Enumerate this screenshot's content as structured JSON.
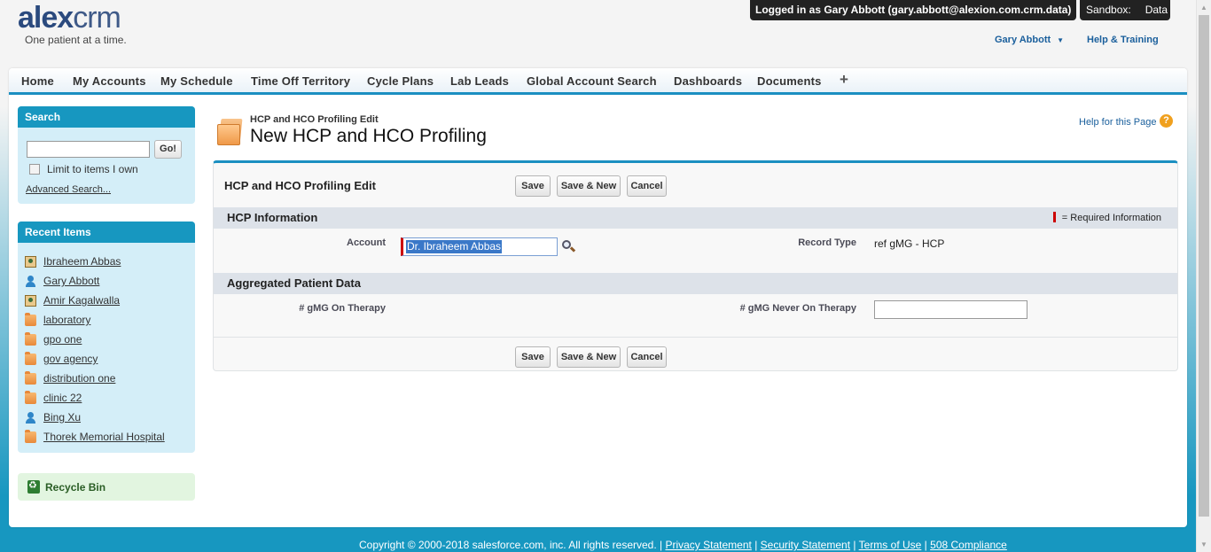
{
  "logo": {
    "brand_bold": "alex",
    "brand_light": "crm",
    "tagline": "One patient at a time."
  },
  "header": {
    "login_text": "Logged in as Gary Abbott (gary.abbott@alexion.com.crm.data)",
    "sandbox_label": "Sandbox:",
    "sandbox_value": "Data",
    "user_name": "Gary Abbott",
    "help_training": "Help & Training"
  },
  "tabs": [
    "Home",
    "My Accounts",
    "My Schedule",
    "Time Off Territory",
    "Cycle Plans",
    "Lab Leads",
    "Global Account Search",
    "Dashboards",
    "Documents"
  ],
  "tab_plus": "+",
  "sidebar": {
    "search_title": "Search",
    "search_value": "",
    "go_label": "Go!",
    "limit_label": "Limit to items I own",
    "advanced_link": "Advanced Search...",
    "recent_title": "Recent Items",
    "recent_items": [
      {
        "label": "Ibraheem Abbas",
        "icon": "contact-icon"
      },
      {
        "label": "Gary Abbott",
        "icon": "user-icon"
      },
      {
        "label": "Amir Kagalwalla",
        "icon": "contact-icon"
      },
      {
        "label": "laboratory",
        "icon": "folder-icon"
      },
      {
        "label": "gpo one",
        "icon": "folder-icon"
      },
      {
        "label": "gov agency",
        "icon": "folder-icon"
      },
      {
        "label": "distribution one",
        "icon": "folder-icon"
      },
      {
        "label": "clinic 22",
        "icon": "folder-icon"
      },
      {
        "label": "Bing Xu",
        "icon": "user-icon"
      },
      {
        "label": "Thorek Memorial Hospital",
        "icon": "folder-icon"
      }
    ],
    "recycle_bin": "Recycle Bin"
  },
  "page": {
    "subtitle": "HCP and HCO Profiling Edit",
    "title": "New HCP and HCO Profiling",
    "help_link": "Help for this Page",
    "help_icon": "?"
  },
  "form": {
    "panel_title": "HCP and HCO Profiling Edit",
    "buttons": {
      "save": "Save",
      "save_new": "Save & New",
      "cancel": "Cancel"
    },
    "required_legend": "= Required Information",
    "section1": {
      "title": "HCP Information",
      "account_label": "Account",
      "account_value": "Dr. Ibraheem Abbas",
      "record_type_label": "Record Type",
      "record_type_value": "ref gMG - HCP"
    },
    "section2": {
      "title": "Aggregated Patient Data",
      "on_therapy_label": "# gMG On Therapy",
      "never_on_therapy_label": "# gMG Never On Therapy",
      "never_on_therapy_value": ""
    }
  },
  "footer": {
    "copyright": "Copyright © 2000-2018 salesforce.com, inc. All rights reserved. |",
    "links": [
      "Privacy Statement",
      "Security Statement",
      "Terms of Use",
      "508 Compliance"
    ],
    "sep": "|"
  },
  "colors": {
    "accent": "#1797c0",
    "link": "#1a5f9c",
    "required": "#cc0000"
  }
}
